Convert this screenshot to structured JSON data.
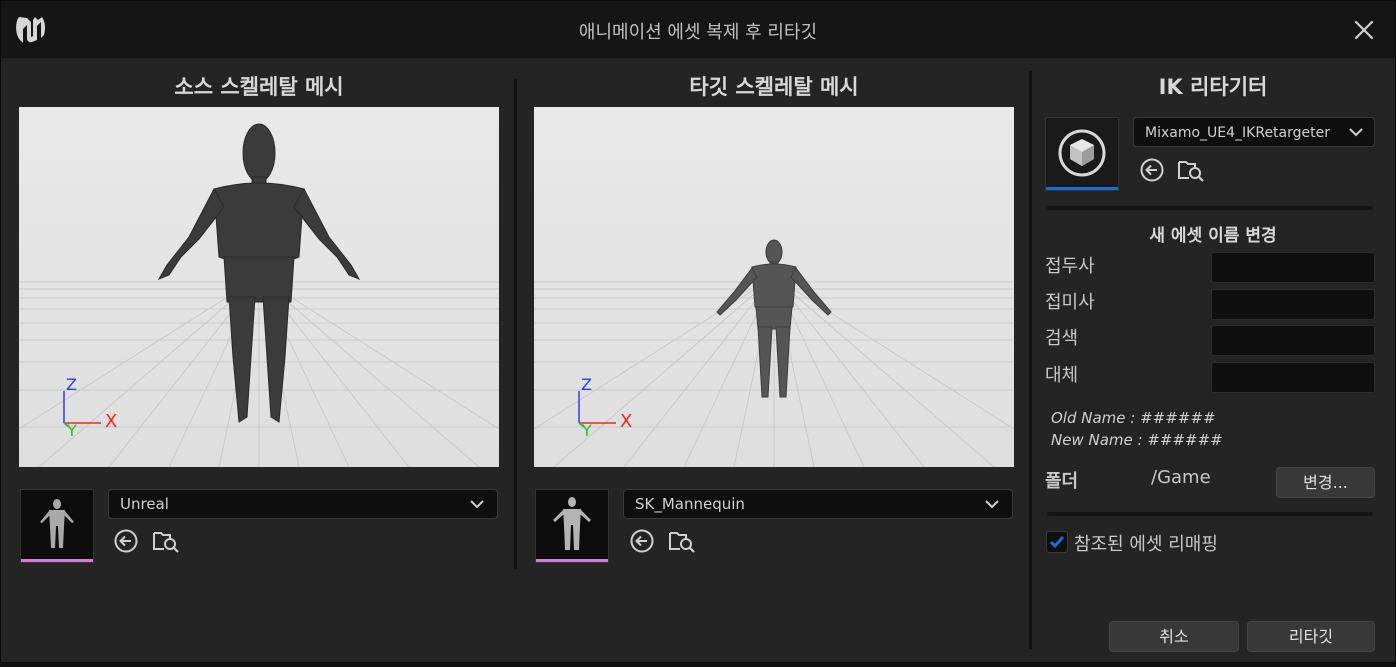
{
  "window": {
    "title": "애니메이션 에셋 복제 후 리타깃"
  },
  "source": {
    "heading": "소스 스켈레탈 메시",
    "mesh_value": "Unreal",
    "axis_z": "Z",
    "axis_y": "Y",
    "axis_x": "X"
  },
  "target": {
    "heading": "타깃 스켈레탈 메시",
    "mesh_value": "SK_Mannequin",
    "axis_z": "Z",
    "axis_y": "Y",
    "axis_x": "X"
  },
  "retargeter": {
    "heading": "IK 리타기터",
    "asset_value": "Mixamo_UE4_IKRetargeter"
  },
  "rename": {
    "heading": "새 에셋 이름 변경",
    "prefix_label": "접두사",
    "suffix_label": "접미사",
    "search_label": "검색",
    "replace_label": "대체",
    "prefix_value": "",
    "suffix_value": "",
    "search_value": "",
    "replace_value": "",
    "old_name": "Old Name : ######",
    "new_name": "New Name : ######"
  },
  "folder": {
    "label": "폴더",
    "path": "/Game",
    "change_button": "변경..."
  },
  "remap": {
    "label": "참조된 에셋 리매핑",
    "checked": true
  },
  "actions": {
    "cancel": "취소",
    "retarget": "리타깃"
  },
  "colors": {
    "accent_blue": "#1f6cd8",
    "thumb_bar": "#d77ed7",
    "axis_x": "#ff2020",
    "axis_y": "#26c026",
    "axis_z": "#2a3cff"
  },
  "icons": {
    "use_selected": "arrow-left-circle-icon",
    "browse": "folder-search-icon",
    "dropdown": "chevron-down-icon",
    "close": "close-icon",
    "logo": "unreal-logo-icon",
    "retargeter_asset": "cube-icon"
  }
}
